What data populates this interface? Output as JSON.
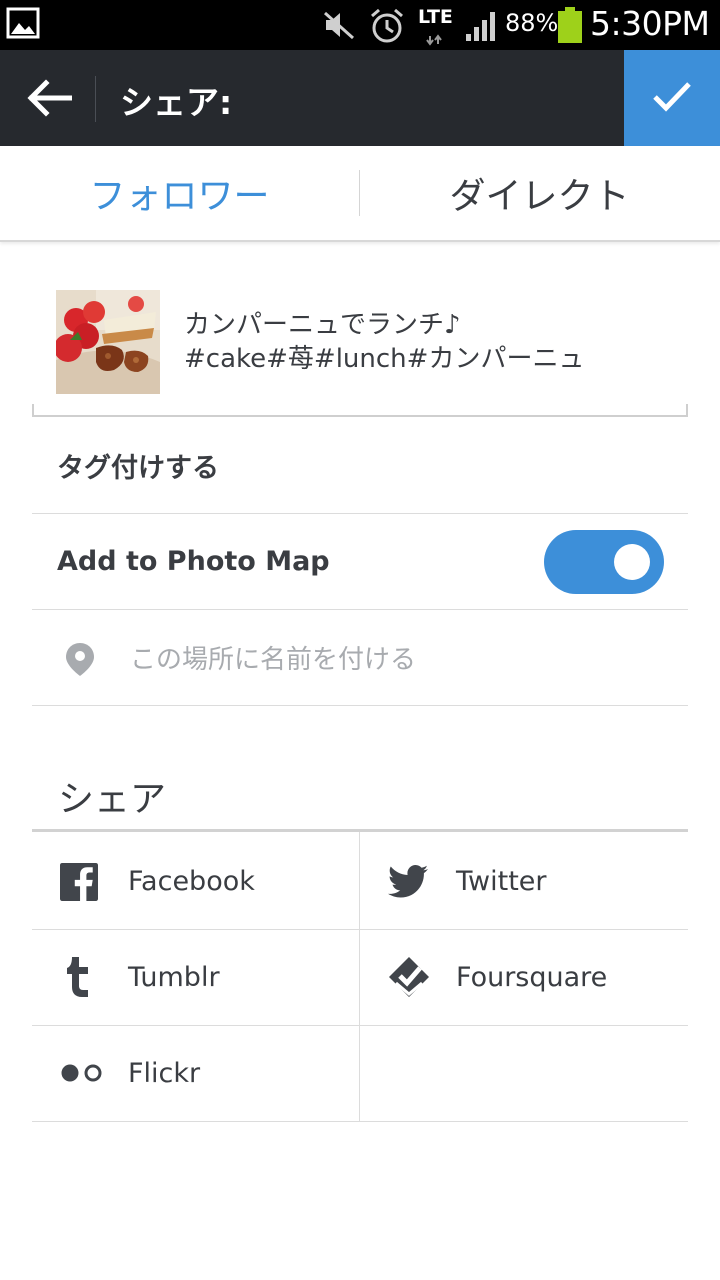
{
  "status_bar": {
    "network": "LTE",
    "battery_percent": "88%",
    "time": "5:30PM",
    "icons": [
      "gallery-icon",
      "mute-icon",
      "alarm-icon",
      "lte-icon",
      "signal-icon",
      "battery-icon"
    ]
  },
  "action_bar": {
    "title": "シェア:",
    "back_icon": "arrow-left-icon",
    "confirm_icon": "checkmark-icon",
    "accent_color": "#3d8fd9",
    "background_color": "#26292e"
  },
  "tabs": [
    {
      "label": "フォロワー",
      "active": true
    },
    {
      "label": "ダイレクト",
      "active": false
    }
  ],
  "caption": {
    "line1": "カンパーニュでランチ♪",
    "line2": "#cake#苺#lunch#カンパーニュ"
  },
  "options": {
    "tag_people": "タグ付けする",
    "photo_map_label": "Add to Photo Map",
    "photo_map_enabled": true,
    "location_placeholder": "この場所に名前を付ける"
  },
  "share": {
    "heading": "シェア",
    "services": [
      {
        "label": "Facebook",
        "icon": "facebook-icon"
      },
      {
        "label": "Twitter",
        "icon": "twitter-icon"
      },
      {
        "label": "Tumblr",
        "icon": "tumblr-icon"
      },
      {
        "label": "Foursquare",
        "icon": "foursquare-icon"
      },
      {
        "label": "Flickr",
        "icon": "flickr-icon"
      }
    ]
  }
}
